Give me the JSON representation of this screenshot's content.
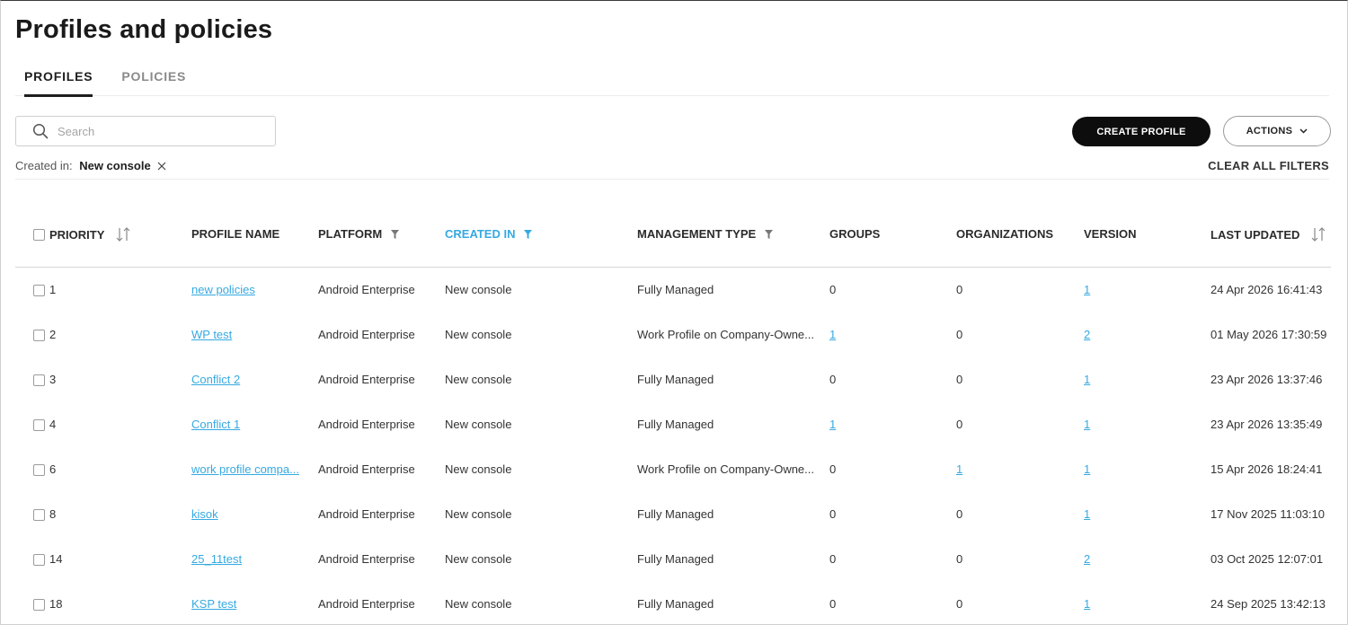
{
  "page": {
    "title": "Profiles and policies"
  },
  "tabs": [
    {
      "label": "PROFILES",
      "active": true
    },
    {
      "label": "POLICIES",
      "active": false
    }
  ],
  "search": {
    "placeholder": "Search",
    "value": ""
  },
  "buttons": {
    "create_profile": "CREATE PROFILE",
    "actions": "ACTIONS"
  },
  "filters": {
    "label": "Created in:",
    "chip": "New console",
    "clear_all": "CLEAR ALL FILTERS"
  },
  "colors": {
    "accent": "#36a9e1",
    "primary_button": "#0d0d0d"
  },
  "table": {
    "headers": {
      "priority": "PRIORITY",
      "profile_name": "PROFILE NAME",
      "platform": "PLATFORM",
      "created_in": "CREATED IN",
      "management_type": "MANAGEMENT TYPE",
      "groups": "GROUPS",
      "organizations": "ORGANIZATIONS",
      "version": "VERSION",
      "last_updated": "LAST UPDATED"
    },
    "rows": [
      {
        "priority": "1",
        "name": "new policies",
        "platform": "Android Enterprise",
        "created_in": "New console",
        "management": "Fully Managed",
        "groups": "0",
        "groups_link": false,
        "orgs": "0",
        "orgs_link": false,
        "version": "1",
        "updated": "24 Apr 2026 16:41:43"
      },
      {
        "priority": "2",
        "name": "WP test",
        "platform": "Android Enterprise",
        "created_in": "New console",
        "management": "Work Profile on Company-Owne...",
        "groups": "1",
        "groups_link": true,
        "orgs": "0",
        "orgs_link": false,
        "version": "2",
        "updated": "01 May 2026 17:30:59"
      },
      {
        "priority": "3",
        "name": "Conflict 2",
        "platform": "Android Enterprise",
        "created_in": "New console",
        "management": "Fully Managed",
        "groups": "0",
        "groups_link": false,
        "orgs": "0",
        "orgs_link": false,
        "version": "1",
        "updated": "23 Apr 2026 13:37:46"
      },
      {
        "priority": "4",
        "name": "Conflict 1",
        "platform": "Android Enterprise",
        "created_in": "New console",
        "management": "Fully Managed",
        "groups": "1",
        "groups_link": true,
        "orgs": "0",
        "orgs_link": false,
        "version": "1",
        "updated": "23 Apr 2026 13:35:49"
      },
      {
        "priority": "6",
        "name": "work profile compa...",
        "platform": "Android Enterprise",
        "created_in": "New console",
        "management": "Work Profile on Company-Owne...",
        "groups": "0",
        "groups_link": false,
        "orgs": "1",
        "orgs_link": true,
        "version": "1",
        "updated": "15 Apr 2026 18:24:41"
      },
      {
        "priority": "8",
        "name": "kisok",
        "platform": "Android Enterprise",
        "created_in": "New console",
        "management": "Fully Managed",
        "groups": "0",
        "groups_link": false,
        "orgs": "0",
        "orgs_link": false,
        "version": "1",
        "updated": "17 Nov 2025 11:03:10"
      },
      {
        "priority": "14",
        "name": "25_11test",
        "platform": "Android Enterprise",
        "created_in": "New console",
        "management": "Fully Managed",
        "groups": "0",
        "groups_link": false,
        "orgs": "0",
        "orgs_link": false,
        "version": "2",
        "updated": "03 Oct 2025 12:07:01"
      },
      {
        "priority": "18",
        "name": "KSP test",
        "platform": "Android Enterprise",
        "created_in": "New console",
        "management": "Fully Managed",
        "groups": "0",
        "groups_link": false,
        "orgs": "0",
        "orgs_link": false,
        "version": "1",
        "updated": "24 Sep 2025 13:42:13"
      }
    ]
  }
}
